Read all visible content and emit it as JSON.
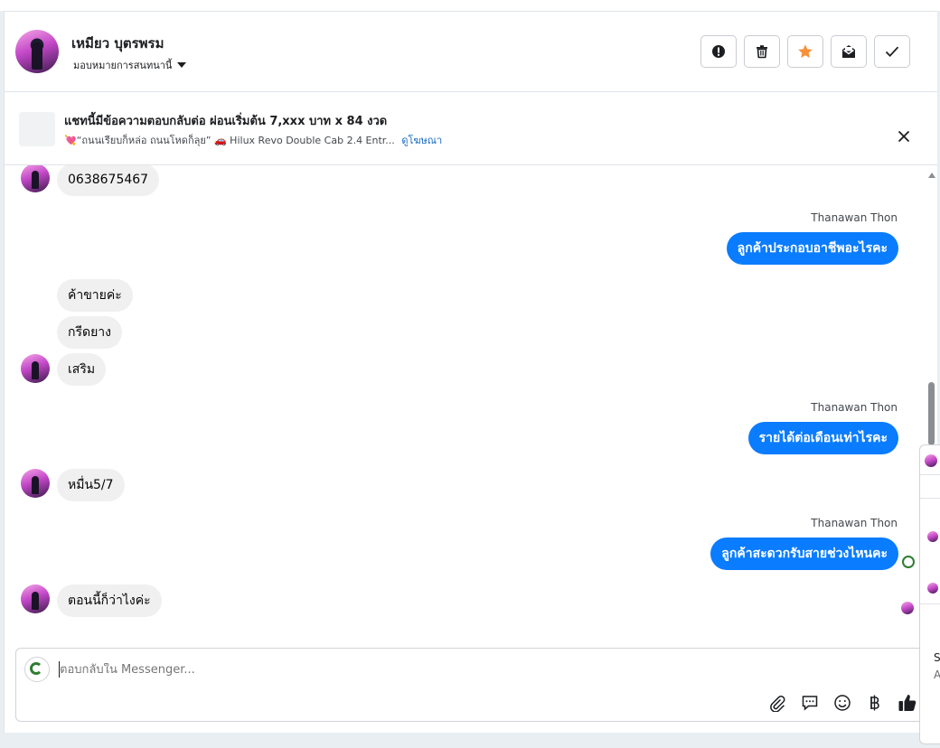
{
  "header": {
    "contact_name": "เหมียว บุตรพรม",
    "assign_label": "มอบหมายการสนทนานี้",
    "actions": {
      "spam": "spam-icon",
      "delete": "trash-icon",
      "star": "star-icon",
      "unread": "envelope-icon",
      "done": "check-icon"
    },
    "accent_star": "#f7923a"
  },
  "ad": {
    "title": "แชทนี้มีข้อความตอบกลับต่อ ผ่อนเริ่มต้น 7,xxx บาท x 84 งวด",
    "subtitle": "💘“ถนนเรียบก็หล่อ ถนนโหดก็ลุย” 🚗 Hilux Revo Double Cab 2.4 Entr...",
    "link": "ดูโฆษณา"
  },
  "messages": [
    {
      "dir": "in",
      "text": "0638675467"
    },
    {
      "dir": "out",
      "sender": "Thanawan Thon",
      "text": "ลูกค้าประกอบอาชีพอะไรคะ"
    },
    {
      "dir": "in",
      "text": "ค้าขายค่ะ"
    },
    {
      "dir": "in",
      "text": "กรีดยาง"
    },
    {
      "dir": "in",
      "text": "เสริม"
    },
    {
      "dir": "out",
      "sender": "Thanawan Thon",
      "text": "รายได้ต่อเดือนเท่าไรคะ"
    },
    {
      "dir": "in",
      "text": "หมื่น5/7"
    },
    {
      "dir": "out",
      "sender": "Thanawan Thon",
      "text": "ลูกค้าสะดวกรับสายช่วงไหนคะ"
    },
    {
      "dir": "in",
      "text": "ตอนนี้ก็ว่าไงค่ะ"
    }
  ],
  "composer": {
    "placeholder": "ตอบกลับใน Messenger...",
    "tools": [
      "paperclip-icon",
      "quick-reply-icon",
      "emoji-icon",
      "baht-icon",
      "thumbs-up-icon"
    ]
  },
  "side_popup": {
    "text1": "S",
    "text2": "A"
  },
  "colors": {
    "outgoing_bubble": "#0a7cff",
    "incoming_bubble": "#f0f0f0",
    "link": "#1768c4"
  }
}
